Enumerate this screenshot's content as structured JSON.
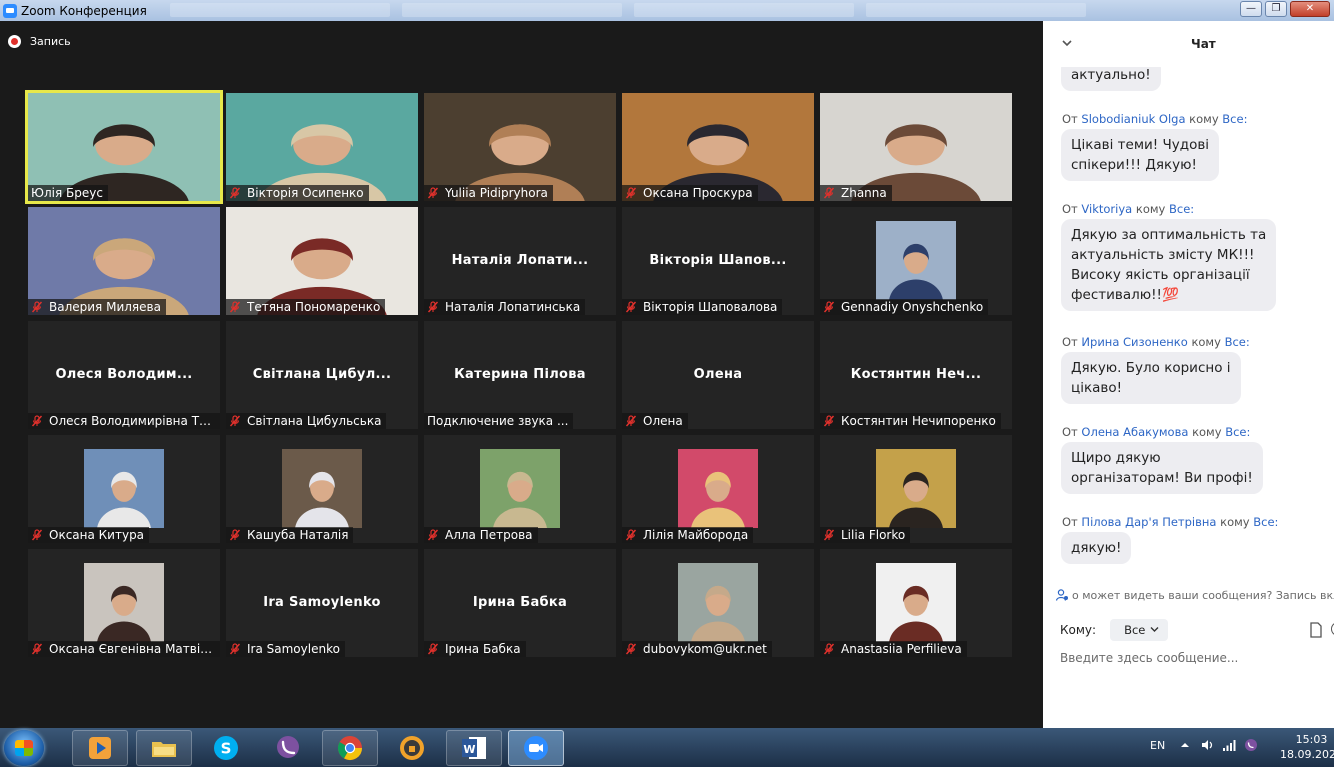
{
  "window": {
    "title": "Zoom Конференция"
  },
  "recording": {
    "label": "Запись"
  },
  "participants": [
    {
      "name": "Юлія Бреус",
      "active": true,
      "muted": false,
      "media": "video",
      "bg": "#8fc0b4",
      "fg": "#2e2622"
    },
    {
      "name": "Вікторія Осипенко",
      "muted": true,
      "media": "video",
      "bg": "#5aa8a0",
      "fg": "#d8c7a6"
    },
    {
      "name": "Yuliia Pidipryhora",
      "muted": true,
      "media": "video",
      "bg": "#4c3f30",
      "fg": "#b07f56"
    },
    {
      "name": "Оксана Проскура",
      "muted": true,
      "media": "video",
      "bg": "#b2773c",
      "fg": "#2a2830"
    },
    {
      "name": "Zhanna",
      "muted": true,
      "media": "video",
      "bg": "#d7d5d0",
      "fg": "#6b4a38"
    },
    {
      "name": "Валерия Миляева",
      "muted": true,
      "media": "video",
      "bg": "#6f7aa8",
      "fg": "#caa77a"
    },
    {
      "name": "Тетяна Пономаренко",
      "muted": true,
      "media": "video",
      "bg": "#e9e6e0",
      "fg": "#7a2a26"
    },
    {
      "name": "Наталія Лопатинська",
      "display": "Наталія Лопати...",
      "muted": true,
      "media": "none"
    },
    {
      "name": "Вікторія Шаповалова",
      "display": "Вікторія Шапов...",
      "muted": true,
      "media": "none"
    },
    {
      "name": "Gennadiy Onyshchenko",
      "muted": true,
      "media": "thumb",
      "bg": "#9db0c8",
      "fg": "#2d3f6a"
    },
    {
      "name": "Олеся Володимирівна Ти...",
      "display": "Олеся Володим...",
      "muted": true,
      "media": "none"
    },
    {
      "name": "Світлана Цибульська",
      "display": "Світлана Цибул...",
      "muted": true,
      "media": "none"
    },
    {
      "name": "Подключение звука ...",
      "display": "Катерина Пілова",
      "muted": false,
      "media": "none"
    },
    {
      "name": "Олена",
      "display": "Олена",
      "muted": true,
      "media": "none"
    },
    {
      "name": "Костянтин Нечипоренко",
      "display": "Костянтин Неч...",
      "muted": true,
      "media": "none"
    },
    {
      "name": "Оксана Китура",
      "muted": true,
      "media": "thumb",
      "bg": "#6f8fb8",
      "fg": "#e8e8e8"
    },
    {
      "name": "Кашуба Наталія",
      "muted": true,
      "media": "thumb",
      "bg": "#6b5a4a",
      "fg": "#e4e4ea"
    },
    {
      "name": "Алла Петрова",
      "muted": true,
      "media": "thumb",
      "bg": "#7da26a",
      "fg": "#c8b890"
    },
    {
      "name": "Лілія Майборода",
      "muted": true,
      "media": "thumb",
      "bg": "#d24a6a",
      "fg": "#e9c27a"
    },
    {
      "name": "Lilia Florko",
      "muted": true,
      "media": "thumb",
      "bg": "#c4a14a",
      "fg": "#2a2420"
    },
    {
      "name": "Оксана Євгенівна Матвійч...",
      "muted": true,
      "media": "thumb",
      "bg": "#c9c4be",
      "fg": "#3a2824"
    },
    {
      "name": "Ira Samoylenko",
      "display": "Ira Samoylenko",
      "muted": true,
      "media": "none"
    },
    {
      "name": "Ірина Бабка",
      "display": "Ірина Бабка",
      "muted": true,
      "media": "none"
    },
    {
      "name": "dubovykom@ukr.net",
      "muted": true,
      "media": "thumb",
      "bg": "#9aa5a0",
      "fg": "#c5a98a"
    },
    {
      "name": "Anastasiia Perfilieva",
      "muted": true,
      "media": "thumb",
      "bg": "#f0f0f0",
      "fg": "#6a2c24"
    }
  ],
  "chat": {
    "title": "Чат",
    "messages": [
      {
        "text": "актуально!"
      },
      {
        "from_prefix": "От",
        "sender": "Slobodianiuk Olga",
        "to_word": "кому",
        "to": "Все:",
        "text_lines": [
          "Цікаві теми! Чудові",
          "спікери!!! Дякую!"
        ]
      },
      {
        "from_prefix": "От",
        "sender": "Viktoriya",
        "to_word": "кому",
        "to": "Все:",
        "text_lines": [
          "Дякую за оптимальність  та",
          "актуальність  змісту  МК!!!",
          "Високу якість організації",
          "фестивалю!!💯"
        ]
      },
      {
        "from_prefix": "От",
        "sender": "Ирина Сизоненко",
        "to_word": "кому",
        "to": "Все:",
        "text_lines": [
          "Дякую. Було корисно і",
          "цікаво!"
        ]
      },
      {
        "from_prefix": "От",
        "sender": "Олена Абакумова",
        "to_word": "кому",
        "to": "Все:",
        "text_lines": [
          "Щиро дякую",
          "організаторам! Ви профі!"
        ]
      },
      {
        "from_prefix": "От",
        "sender": "Пілова Дар'я Петрівна",
        "to_word": "кому",
        "to": "Все:",
        "text_lines": [
          "дякую!"
        ]
      }
    ],
    "notice": "о может видеть ваши сообщения? Запись вкл",
    "to_label": "Кому:",
    "to_value": "Все",
    "input_placeholder": "Введите здесь сообщение..."
  },
  "taskbar": {
    "apps": [
      "media-player",
      "file-explorer",
      "skype",
      "viber",
      "chrome",
      "security",
      "word",
      "zoom"
    ],
    "language": "EN",
    "time": "15:03",
    "date": "18.09.2021"
  },
  "colors": {
    "active_speaker": "#e7e84a",
    "chat_link": "#2d66c5",
    "mute_red": "#e0312c"
  }
}
